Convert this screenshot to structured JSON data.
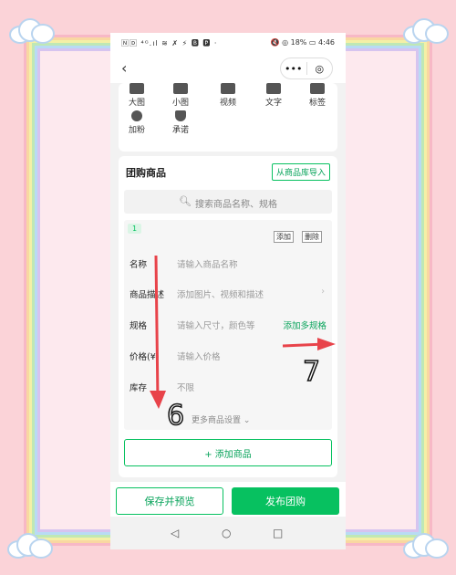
{
  "status_bar": {
    "left": "🄽🄳 ⁴ᴳ.ıl ≋ ✗ ⚡ 🅱 🅿 ·",
    "right": "🔇 ◎ 18% ▭ 4:46"
  },
  "nav": {
    "back_icon": "chevron-left-icon",
    "more_glyph": "•••",
    "target_glyph": "◎"
  },
  "icon_grid": [
    {
      "label": "大图",
      "icon": "image-large-icon"
    },
    {
      "label": "小图",
      "icon": "image-grid-icon"
    },
    {
      "label": "视频",
      "icon": "video-icon"
    },
    {
      "label": "文字",
      "icon": "text-icon"
    },
    {
      "label": "标签",
      "icon": "tag-icon"
    },
    {
      "label": "加粉",
      "icon": "add-fan-icon"
    },
    {
      "label": "承诺",
      "icon": "shield-icon"
    }
  ],
  "group": {
    "title": "团购商品",
    "import_label": "从商品库导入",
    "search_placeholder": "搜索商品名称、规格",
    "product": {
      "index": "1",
      "add_label": "添加",
      "delete_label": "删除",
      "rows": [
        {
          "label": "名称",
          "value": "请输入商品名称",
          "action": ""
        },
        {
          "label": "商品描述",
          "value": "添加图片、视频和描述",
          "action": "›"
        },
        {
          "label": "规格",
          "value": "请输入尺寸，颜色等",
          "action": "添加多规格"
        },
        {
          "label": "价格(¥)",
          "value": "请输入价格",
          "action": ""
        },
        {
          "label": "库存",
          "value": "不限",
          "action": ""
        }
      ],
      "more_settings": "更多商品设置 ⌄"
    },
    "add_product": "+ 添加商品"
  },
  "bottom": {
    "save_label": "保存并预览",
    "publish_label": "发布团购"
  },
  "sysnav": {
    "back": "◁",
    "home": "○",
    "recent": "□"
  },
  "annotations": {
    "num_left": "6",
    "num_right": "7"
  },
  "colors": {
    "accent": "#07c160",
    "background": "#fbd3d8"
  }
}
